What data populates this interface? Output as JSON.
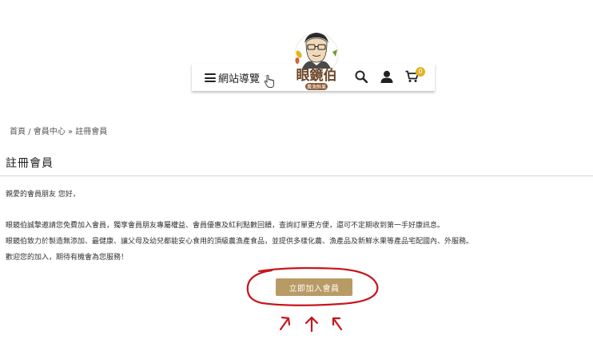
{
  "header": {
    "nav_label": "網站導覽",
    "logo_name": "眼鏡伯",
    "logo_subtitle": "農漁鮮果",
    "cart_count": "0",
    "icons": [
      "menu-icon",
      "search-icon",
      "user-icon",
      "cart-icon"
    ]
  },
  "breadcrumb": {
    "home": "首頁",
    "separator": "/",
    "member_center": "會員中心",
    "separator2": "»",
    "current": "註冊會員"
  },
  "page": {
    "title": "註冊會員",
    "greeting": "親愛的會員朋友 您好，",
    "paragraph1": "眼鏡伯誠摯邀請您免費加入會員，獨享會員朋友專屬權益、會員優惠及紅利點數回饋，查詢訂單更方便，還可不定期收到第一手好康訊息。",
    "paragraph2": "眼鏡伯致力於製造無添加、最健康、讓父母及幼兒都能安心食用的頂級農漁產食品，並提供多樣化農、漁產品及新鮮水果等產品宅配國內、外服務。",
    "paragraph3": "歡迎您的加入，期待有機會為您服務！",
    "cta_label": "立即加入會員"
  },
  "colors": {
    "cta_button": "#b89a65",
    "cart_badge": "#e0b520",
    "annotation": "#c8161d"
  }
}
